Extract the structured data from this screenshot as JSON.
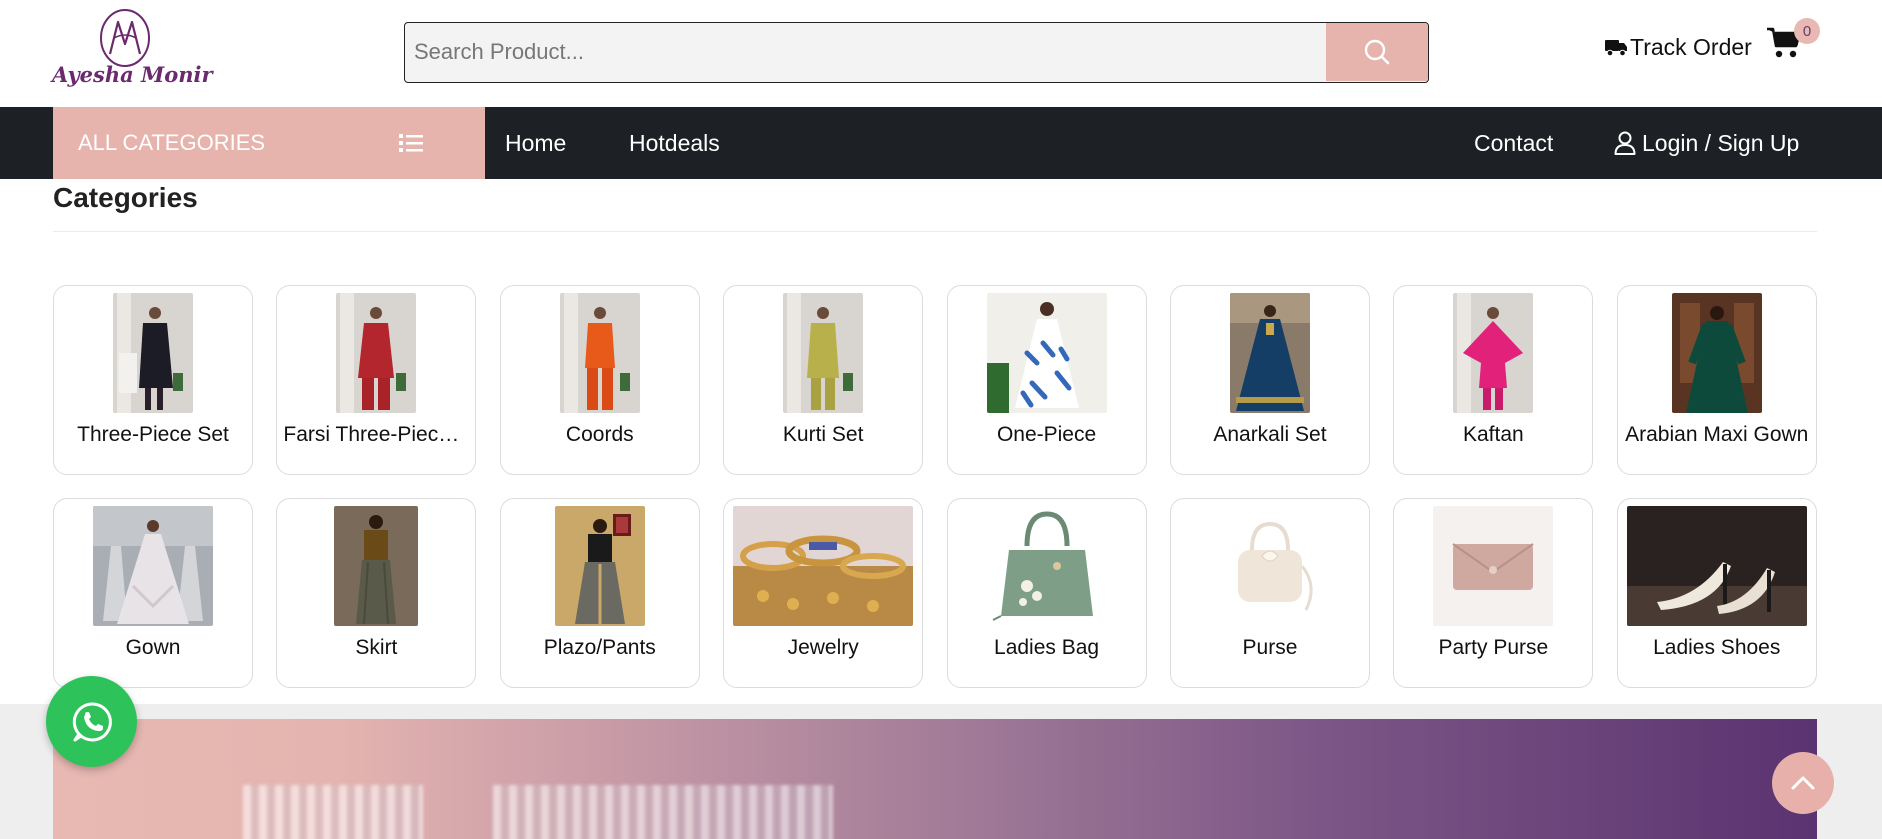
{
  "brand": {
    "name": "Ayesha Monir",
    "monogram": "AM",
    "color": "#6b2a6e"
  },
  "search": {
    "placeholder": "Search Product...",
    "value": ""
  },
  "header": {
    "track_order": "Track Order",
    "cart_count": "0"
  },
  "nav": {
    "all_categories": "ALL CATEGORIES",
    "links": [
      "Home",
      "Hotdeals"
    ],
    "contact": "Contact",
    "login": "Login / Sign Up"
  },
  "section": {
    "title": "Categories"
  },
  "categories": [
    {
      "label": "Three-Piece Set",
      "kind": "dress"
    },
    {
      "label": "Farsi Three-Piece ...",
      "kind": "dress"
    },
    {
      "label": "Coords",
      "kind": "dress"
    },
    {
      "label": "Kurti Set",
      "kind": "dress"
    },
    {
      "label": "One-Piece",
      "kind": "dress"
    },
    {
      "label": "Anarkali Set",
      "kind": "dress"
    },
    {
      "label": "Kaftan",
      "kind": "dress"
    },
    {
      "label": "Arabian Maxi Gown",
      "kind": "dress"
    },
    {
      "label": "Gown",
      "kind": "dress"
    },
    {
      "label": "Skirt",
      "kind": "dress"
    },
    {
      "label": "Plazo/Pants",
      "kind": "dress"
    },
    {
      "label": "Jewelry",
      "kind": "jewelry"
    },
    {
      "label": "Ladies Bag",
      "kind": "bag"
    },
    {
      "label": "Purse",
      "kind": "bag"
    },
    {
      "label": "Party Purse",
      "kind": "clutch"
    },
    {
      "label": "Ladies Shoes",
      "kind": "shoes"
    }
  ],
  "colors": {
    "accent": "#e6b4ad",
    "nav_bg": "#1d2125",
    "whatsapp": "#2ec25a"
  }
}
